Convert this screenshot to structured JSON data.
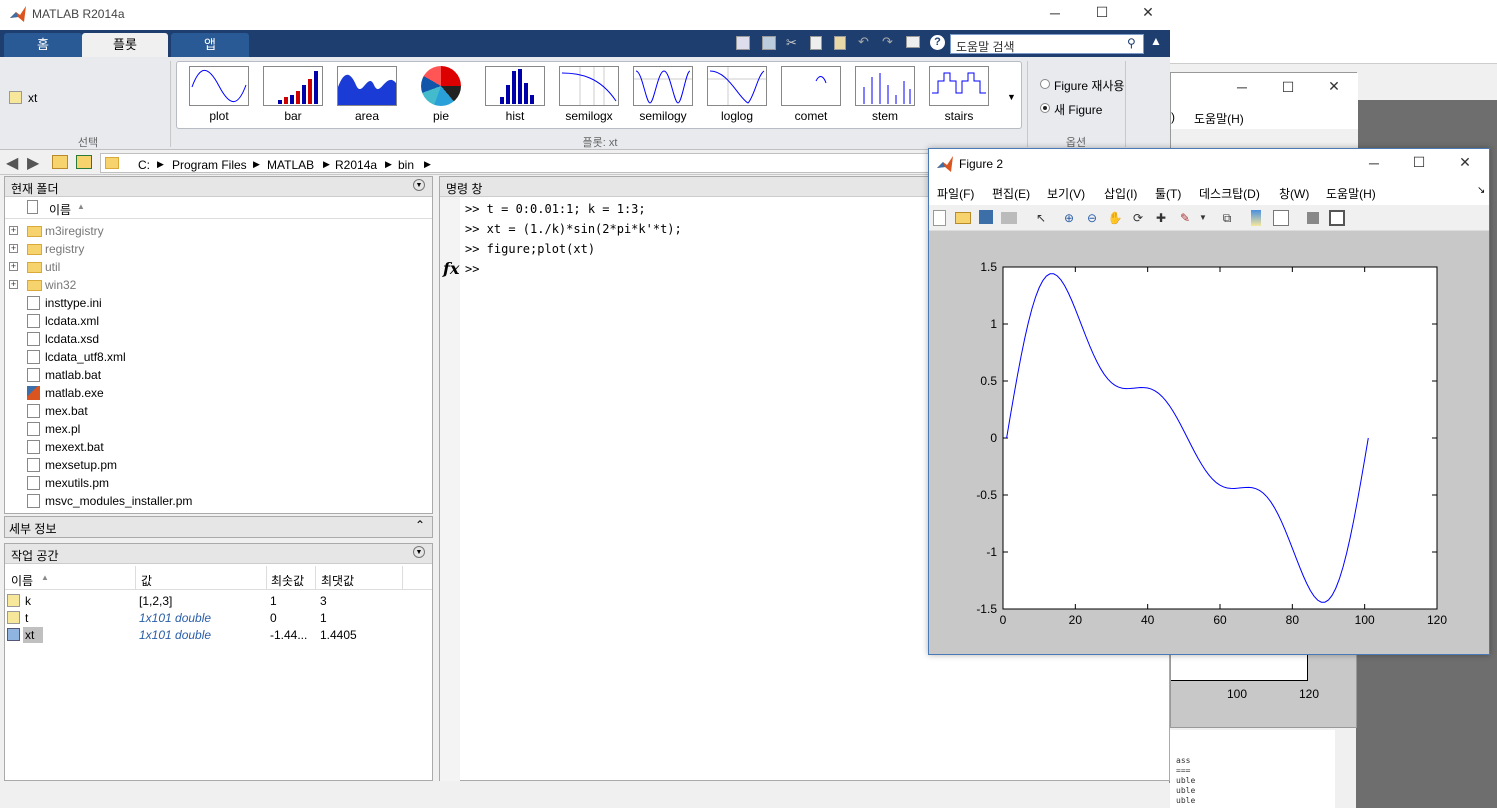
{
  "app_title": "MATLAB R2014a",
  "ribbon_tabs": [
    "홈",
    "플롯",
    "앱"
  ],
  "search_placeholder": "도움말 검색",
  "selection": {
    "variable": "xt",
    "section_label": "선택"
  },
  "plots_section_label": "플롯: xt",
  "options_section_label": "옵션",
  "plot_buttons": [
    "plot",
    "bar",
    "area",
    "pie",
    "hist",
    "semilogx",
    "semilogy",
    "loglog",
    "comet",
    "stem",
    "stairs"
  ],
  "options": {
    "reuse": "Figure 재사용",
    "new": "새 Figure"
  },
  "address": [
    "C:",
    "Program Files",
    "MATLAB",
    "R2014a",
    "bin"
  ],
  "folder_panel": {
    "title": "현재 폴더",
    "column": "이름",
    "items": [
      {
        "name": "m3iregistry",
        "type": "folder"
      },
      {
        "name": "registry",
        "type": "folder"
      },
      {
        "name": "util",
        "type": "folder"
      },
      {
        "name": "win32",
        "type": "folder"
      },
      {
        "name": "insttype.ini",
        "type": "file"
      },
      {
        "name": "lcdata.xml",
        "type": "file"
      },
      {
        "name": "lcdata.xsd",
        "type": "file"
      },
      {
        "name": "lcdata_utf8.xml",
        "type": "file"
      },
      {
        "name": "matlab.bat",
        "type": "file"
      },
      {
        "name": "matlab.exe",
        "type": "exe"
      },
      {
        "name": "mex.bat",
        "type": "file"
      },
      {
        "name": "mex.pl",
        "type": "file"
      },
      {
        "name": "mexext.bat",
        "type": "file"
      },
      {
        "name": "mexsetup.pm",
        "type": "file"
      },
      {
        "name": "mexutils.pm",
        "type": "file"
      },
      {
        "name": "msvc_modules_installer.pm",
        "type": "file"
      }
    ]
  },
  "details_panel": {
    "title": "세부 정보"
  },
  "workspace": {
    "title": "작업 공간",
    "columns": [
      "이름",
      "값",
      "최솟값",
      "최댓값"
    ],
    "rows": [
      {
        "name": "k",
        "value": "[1,2,3]",
        "min": "1",
        "max": "3"
      },
      {
        "name": "t",
        "value": "1x101 double",
        "min": "0",
        "max": "1"
      },
      {
        "name": "xt",
        "value": "1x101 double",
        "min": "-1.44...",
        "max": "1.4405"
      }
    ]
  },
  "command_window": {
    "title": "명령 창",
    "lines": [
      ">> t = 0:0.01:1; k = 1:3;",
      ">> xt = (1./k)*sin(2*pi*k'*t);",
      ">> figure;plot(xt)",
      ">>"
    ],
    "fx": "fx"
  },
  "figure1": {
    "menu_help": "도움말(H)",
    "ticks": [
      "100",
      "120"
    ],
    "menu_partial": ")"
  },
  "figure2": {
    "title": "Figure 2",
    "menu": [
      "파일(F)",
      "편집(E)",
      "보기(V)",
      "삽입(I)",
      "툴(T)",
      "데스크탑(D)",
      "창(W)",
      "도움말(H)"
    ]
  },
  "chart_data": {
    "type": "line",
    "title": "",
    "xlabel": "",
    "ylabel": "",
    "xlim": [
      0,
      120
    ],
    "ylim": [
      -1.5,
      1.5
    ],
    "xticks": [
      0,
      20,
      40,
      60,
      80,
      100,
      120
    ],
    "yticks": [
      -1.5,
      -1,
      -0.5,
      0,
      0.5,
      1,
      1.5
    ],
    "color": "#0000ff",
    "formula": "y = sin(2*pi*t) + sin(4*pi*t)/2 + sin(6*pi*t)/3, t = (x-1)/100",
    "x": [
      1,
      6,
      11,
      14,
      16,
      21,
      26,
      31,
      36,
      41,
      46,
      51,
      56,
      61,
      66,
      71,
      76,
      81,
      86,
      89,
      91,
      96,
      101
    ],
    "values": [
      0,
      1.04,
      1.41,
      1.44,
      1.42,
      1.16,
      0.79,
      0.51,
      0.44,
      0.44,
      0.37,
      0.16,
      -0.16,
      -0.37,
      -0.44,
      -0.44,
      -0.51,
      -0.79,
      -1.16,
      -1.44,
      -1.41,
      -1.04,
      0
    ]
  }
}
